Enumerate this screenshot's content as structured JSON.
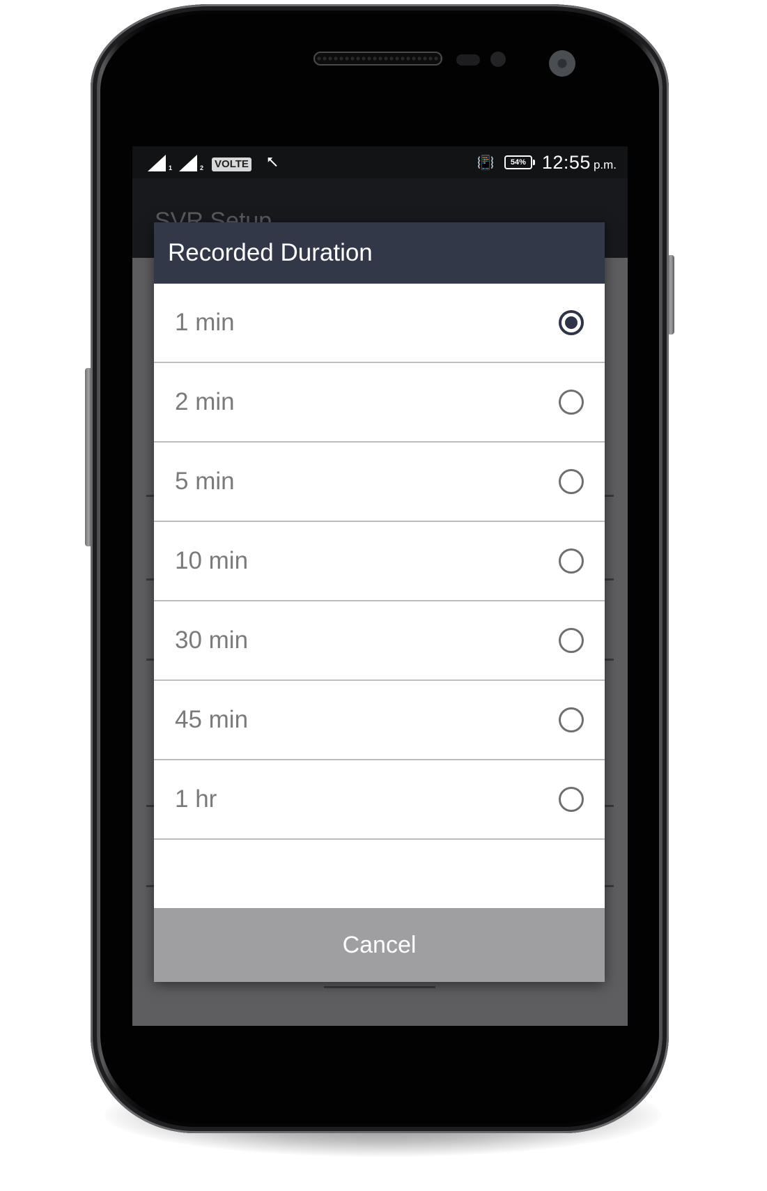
{
  "status_bar": {
    "sim1_label": "1",
    "sim2_label": "2",
    "volte_label": "VOLTE",
    "usb_icon": "usb-icon",
    "vibrate_icon": "vibrate-icon",
    "battery_percent": "54%",
    "time": "12:55",
    "ampm": "p.m."
  },
  "app": {
    "title": "SVR Setup"
  },
  "dialog": {
    "title": "Recorded Duration",
    "options": [
      {
        "label": "1 min",
        "selected": true
      },
      {
        "label": "2 min",
        "selected": false
      },
      {
        "label": "5 min",
        "selected": false
      },
      {
        "label": "10 min",
        "selected": false
      },
      {
        "label": "30 min",
        "selected": false
      },
      {
        "label": "45 min",
        "selected": false
      },
      {
        "label": "1 hr",
        "selected": false
      }
    ],
    "cancel_label": "Cancel"
  },
  "colors": {
    "dialog_header": "#323848",
    "radio_selected": "#2f3547",
    "cancel_bg": "#9f9ea1"
  }
}
